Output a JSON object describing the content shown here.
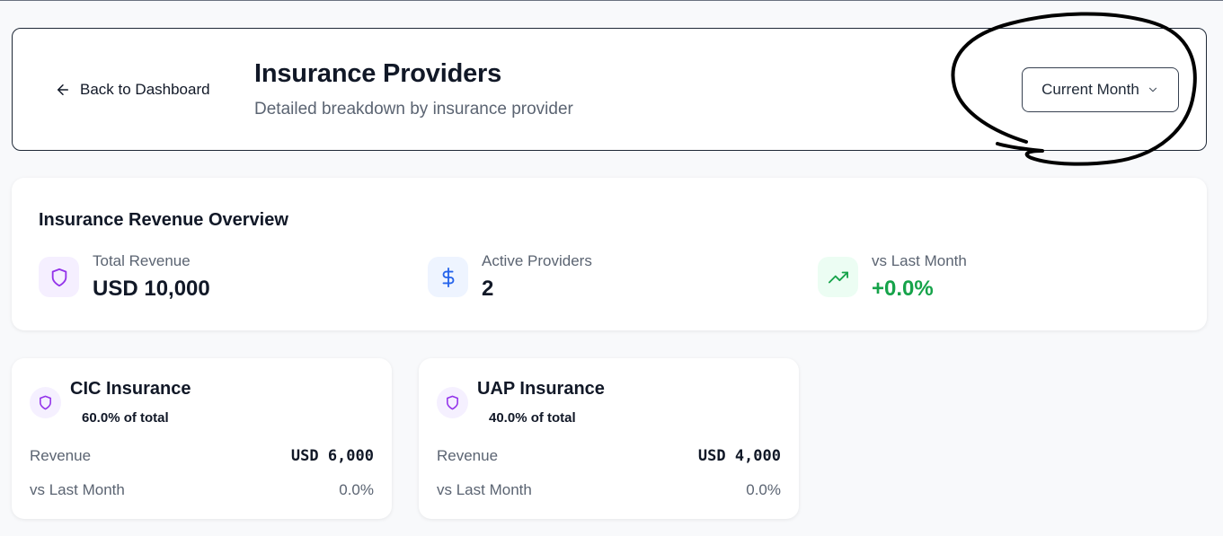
{
  "header": {
    "back_label": "Back to Dashboard",
    "title": "Insurance Providers",
    "subtitle": "Detailed breakdown by insurance provider",
    "period_selected": "Current Month"
  },
  "overview": {
    "title": "Insurance Revenue Overview",
    "stats": [
      {
        "label": "Total Revenue",
        "value": "USD 10,000",
        "icon": "shield-icon"
      },
      {
        "label": "Active Providers",
        "value": "2",
        "icon": "dollar-icon"
      },
      {
        "label": "vs Last Month",
        "value": "+0.0%",
        "icon": "trending-up-icon"
      }
    ]
  },
  "providers": [
    {
      "name": "CIC Insurance",
      "share": "60.0% of total",
      "revenue_label": "Revenue",
      "revenue": "USD 6,000",
      "change_label": "vs Last Month",
      "change": "0.0%"
    },
    {
      "name": "UAP Insurance",
      "share": "40.0% of total",
      "revenue_label": "Revenue",
      "revenue": "USD 4,000",
      "change_label": "vs Last Month",
      "change": "0.0%"
    }
  ],
  "colors": {
    "purple": "#9333ea",
    "blue": "#2563eb",
    "green": "#16a34a"
  }
}
